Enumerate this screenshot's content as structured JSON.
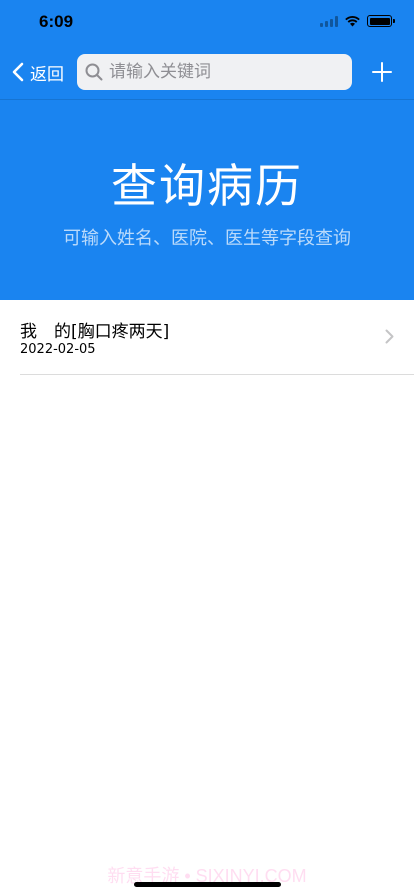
{
  "status_bar": {
    "time": "6:09"
  },
  "nav": {
    "back_label": "返回",
    "search_placeholder": "请输入关键词",
    "search_value": ""
  },
  "hero": {
    "title": "查询病历",
    "subtitle": "可输入姓名、医院、医生等字段查询"
  },
  "records": [
    {
      "title": "我　的[胸口疼两天]",
      "date": "2022-02-05"
    }
  ],
  "watermark": "新意手游 • SIXINYI.COM",
  "colors": {
    "accent": "#1a84f0",
    "search_bg": "#f0f1f3"
  },
  "icons": {
    "back": "chevron-left-icon",
    "search": "search-icon",
    "add": "plus-icon",
    "row": "chevron-right-icon"
  }
}
